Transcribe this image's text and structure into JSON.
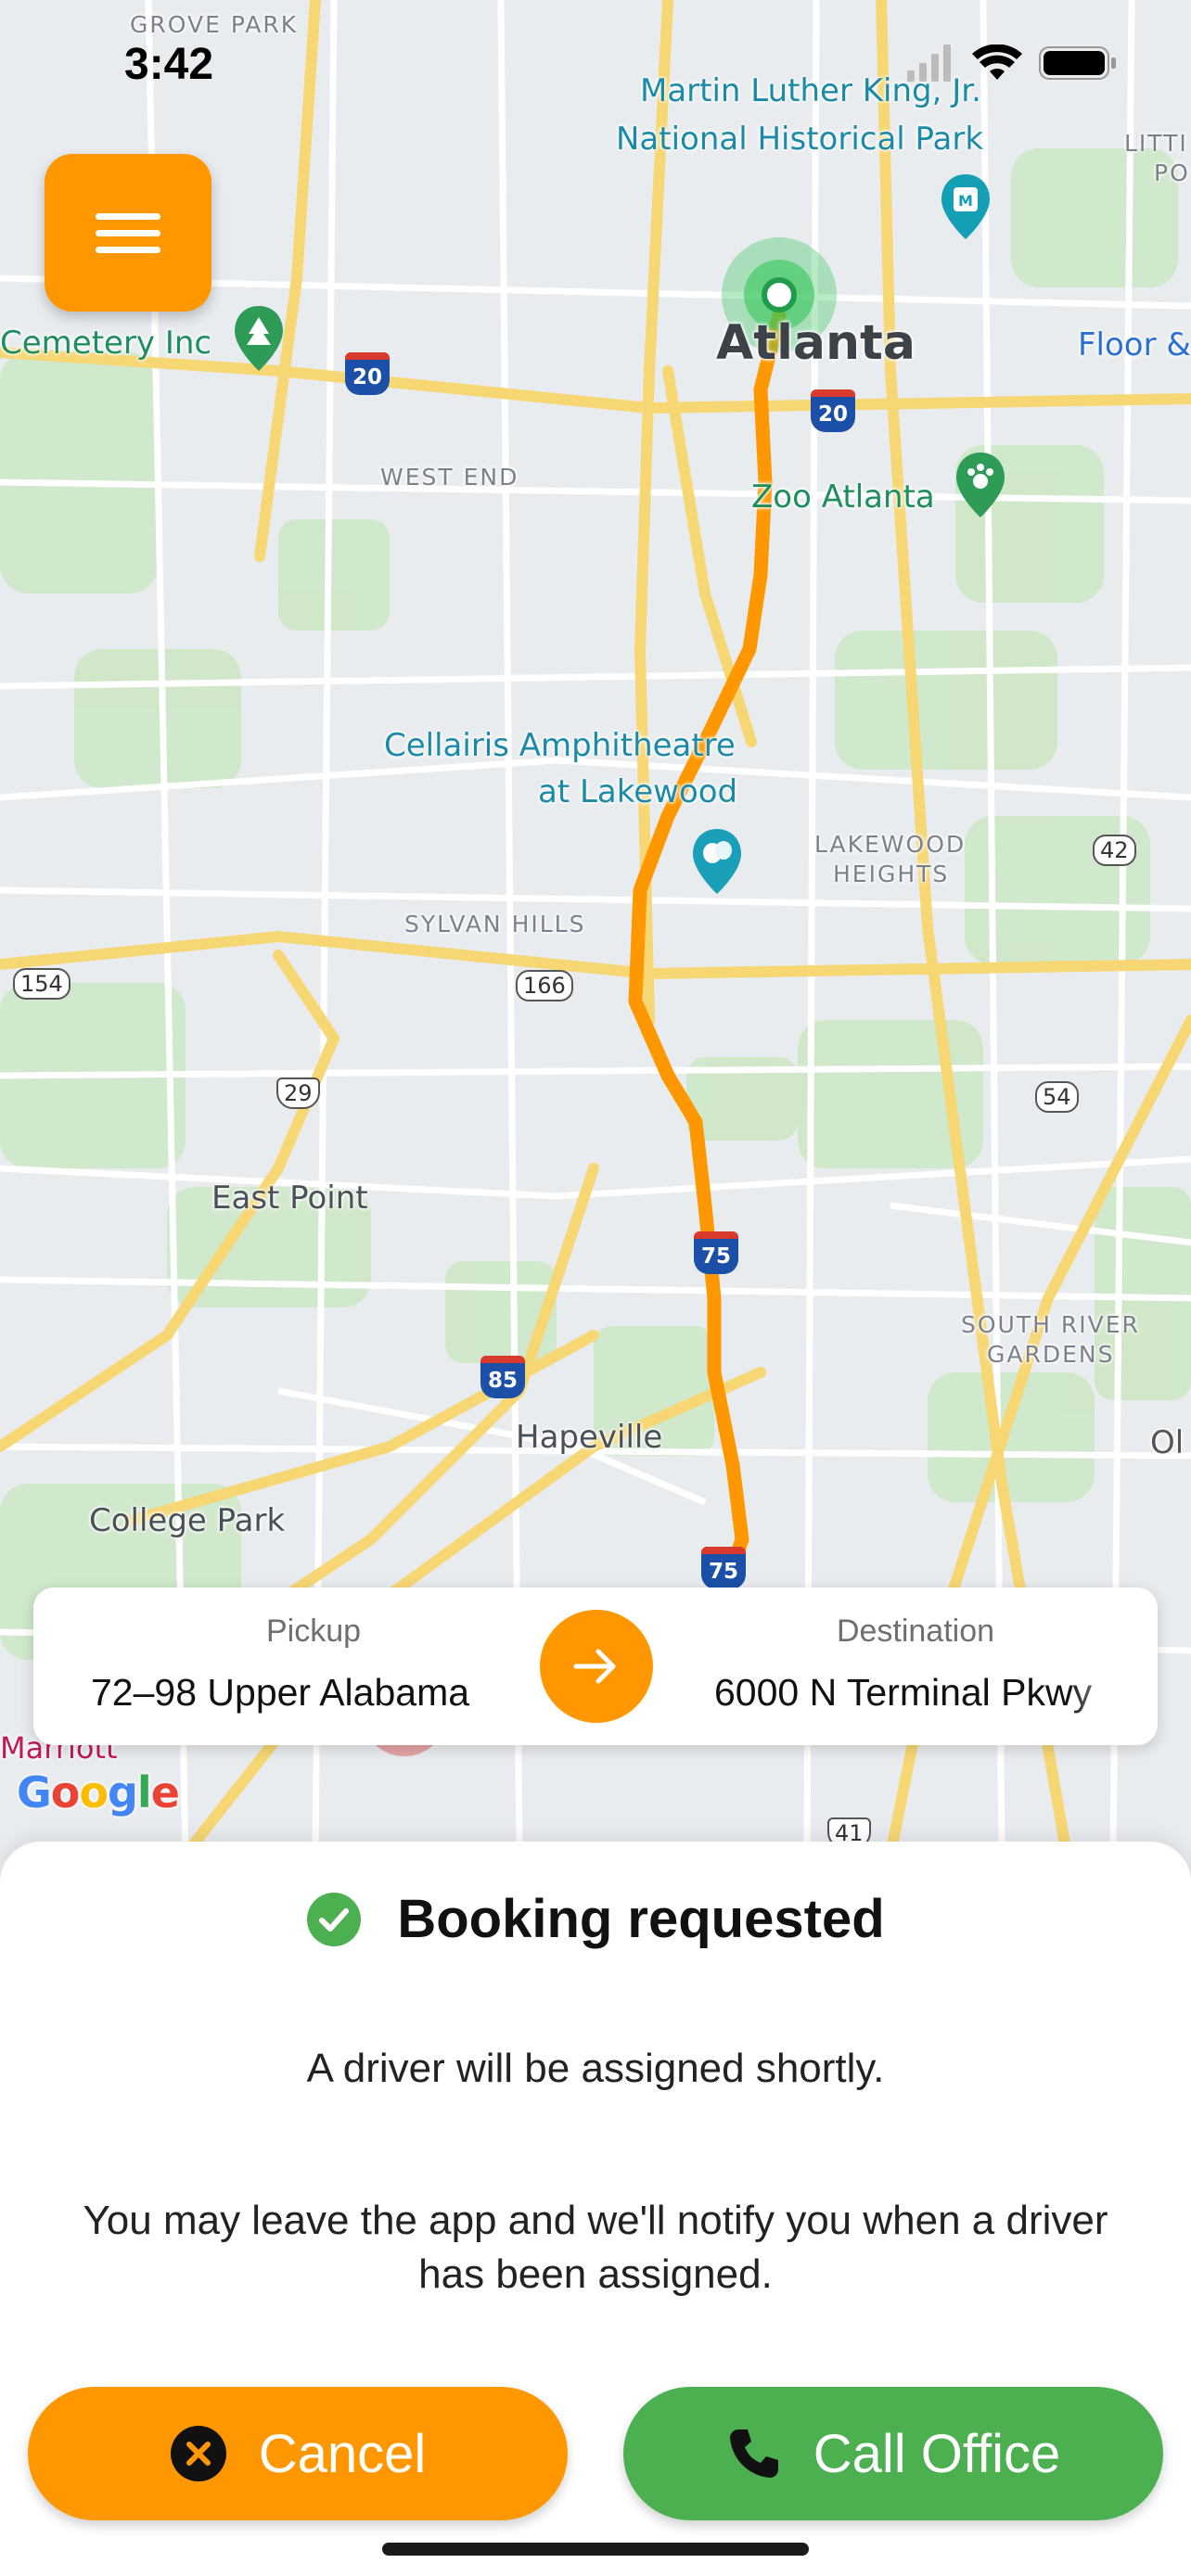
{
  "status_bar": {
    "time": "3:42"
  },
  "map": {
    "labels": {
      "grove_park": "GROVE PARK",
      "mlk_line1": "Martin Luther King, Jr.",
      "mlk_line2": "National Historical Park",
      "litti": "LITTI",
      "po": "PO",
      "cemetery": "Cemetery Inc",
      "atlanta": "Atlanta",
      "floor": "Floor &",
      "west_end": "WEST END",
      "zoo": "Zoo Atlanta",
      "cellairis_line1": "Cellairis Amphitheatre",
      "cellairis_line2": "at Lakewood",
      "lakewood_line1": "LAKEWOOD",
      "lakewood_line2": "HEIGHTS",
      "sylvan": "SYLVAN HILLS",
      "east_point": "East Point",
      "south_river_line1": "SOUTH RIVER",
      "south_river_line2": "GARDENS",
      "hapeville": "Hapeville",
      "college_park": "College Park",
      "marriott": "Marriott",
      "ol": "Ol"
    },
    "shields": {
      "i20_west": "20",
      "i20_east": "20",
      "r42": "42",
      "r154": "154",
      "r166": "166",
      "us29": "29",
      "r54": "54",
      "i75_mid": "75",
      "i85": "85",
      "i75_south": "75",
      "us41": "41"
    },
    "attribution": "Google",
    "colors": {
      "route": "#ff9800",
      "origin": "#34c759"
    }
  },
  "menu_button": {
    "icon": "hamburger-menu-icon"
  },
  "route_card": {
    "pickup_caption": "Pickup",
    "pickup_value": "72–98 Upper Alabama",
    "destination_caption": "Destination",
    "destination_value": "6000 N Terminal Pkwy",
    "swap_icon": "arrow-right-icon"
  },
  "sheet": {
    "title": "Booking requested",
    "title_icon": "check-circle-icon",
    "message_primary": "A driver will be assigned shortly.",
    "message_secondary": "You may leave the app and we'll notify you when a driver has been assigned.",
    "cancel_label": "Cancel",
    "cancel_icon": "close-circle-icon",
    "call_label": "Call Office",
    "call_icon": "phone-icon",
    "colors": {
      "accent": "#ff9800",
      "success": "#4caf50"
    }
  }
}
